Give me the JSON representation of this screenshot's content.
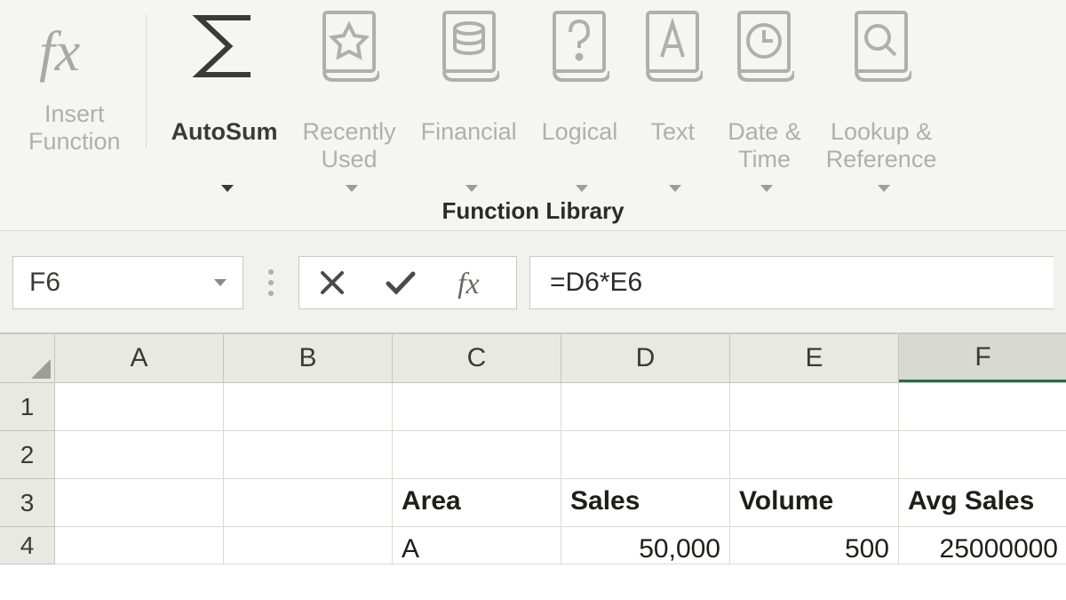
{
  "ribbon": {
    "group_label": "Function Library",
    "items": [
      {
        "id": "insert-function",
        "label": "Insert\nFunction",
        "dropdown": false
      },
      {
        "id": "autosum",
        "label": "AutoSum",
        "dropdown": true,
        "active": true
      },
      {
        "id": "recently-used",
        "label": "Recently\nUsed",
        "dropdown": true
      },
      {
        "id": "financial",
        "label": "Financial",
        "dropdown": true
      },
      {
        "id": "logical",
        "label": "Logical",
        "dropdown": true
      },
      {
        "id": "text",
        "label": "Text",
        "dropdown": true
      },
      {
        "id": "date-time",
        "label": "Date &\nTime",
        "dropdown": true
      },
      {
        "id": "lookup-reference",
        "label": "Lookup &\nReference",
        "dropdown": true
      }
    ]
  },
  "formula_bar": {
    "name_box": "F6",
    "formula": "=D6*E6"
  },
  "sheet": {
    "columns": [
      "A",
      "B",
      "C",
      "D",
      "E",
      "F"
    ],
    "selected_column": "F",
    "rows": [
      {
        "num": 1,
        "cells": [
          "",
          "",
          "",
          "",
          "",
          ""
        ]
      },
      {
        "num": 2,
        "cells": [
          "",
          "",
          "",
          "",
          "",
          ""
        ]
      },
      {
        "num": 3,
        "cells": [
          "",
          "",
          "Area",
          "Sales",
          "Volume",
          "Avg Sales"
        ],
        "header": true
      },
      {
        "num": 4,
        "cells": [
          "",
          "",
          "A",
          "50,000",
          "500",
          "25000000"
        ],
        "numeric_cols": [
          3,
          4,
          5
        ]
      }
    ]
  },
  "icons": {
    "insert-function": "fx",
    "autosum": "sigma",
    "recently-used": "book-star",
    "financial": "book-db",
    "logical": "book-question",
    "text": "book-A",
    "date-time": "book-clock",
    "lookup-reference": "book-search"
  }
}
